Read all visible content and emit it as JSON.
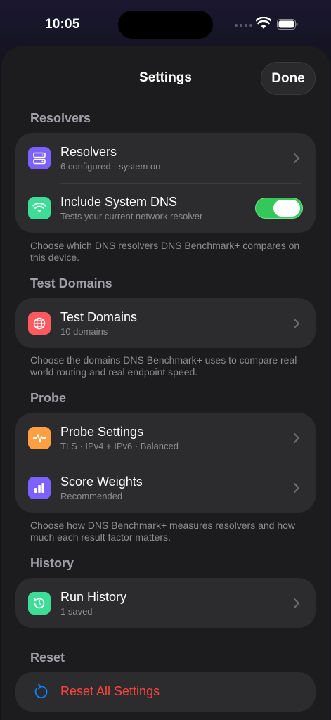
{
  "status_bar": {
    "time": "10:05"
  },
  "sheet": {
    "title": "Settings",
    "done_label": "Done"
  },
  "sections": {
    "resolvers": {
      "header": "Resolvers",
      "rows": [
        {
          "title": "Resolvers",
          "subtitle": "6 configured · system on"
        },
        {
          "title": "Include System DNS",
          "subtitle": "Tests your current network resolver",
          "toggle_on": true
        }
      ],
      "footnote": "Choose which DNS resolvers DNS Benchmark+ compares on this device."
    },
    "test_domains": {
      "header": "Test Domains",
      "rows": [
        {
          "title": "Test Domains",
          "subtitle": "10 domains"
        }
      ],
      "footnote": "Choose the domains DNS Benchmark+ uses to compare real-world routing and real endpoint speed."
    },
    "probe": {
      "header": "Probe",
      "rows": [
        {
          "title": "Probe Settings",
          "subtitle": "TLS · IPv4 + IPv6 · Balanced"
        },
        {
          "title": "Score Weights",
          "subtitle": "Recommended"
        }
      ],
      "footnote": "Choose how DNS Benchmark+ measures resolvers and how much each result factor matters."
    },
    "history": {
      "header": "History",
      "rows": [
        {
          "title": "Run History",
          "subtitle": "1 saved"
        }
      ]
    },
    "reset": {
      "header": "Reset",
      "rows": [
        {
          "title": "Reset All Settings"
        }
      ]
    }
  },
  "colors": {
    "resolvers_icon": "#7b61ff",
    "system_dns_icon": "#3ddc97",
    "test_domains_icon": "#ff5a5f",
    "probe_settings_icon": "#ff9f43",
    "score_weights_icon": "#7b61ff",
    "run_history_icon": "#3ddc97",
    "reset_icon": "#0a84ff",
    "toggle_on": "#34c759",
    "destructive": "#ff453a"
  }
}
